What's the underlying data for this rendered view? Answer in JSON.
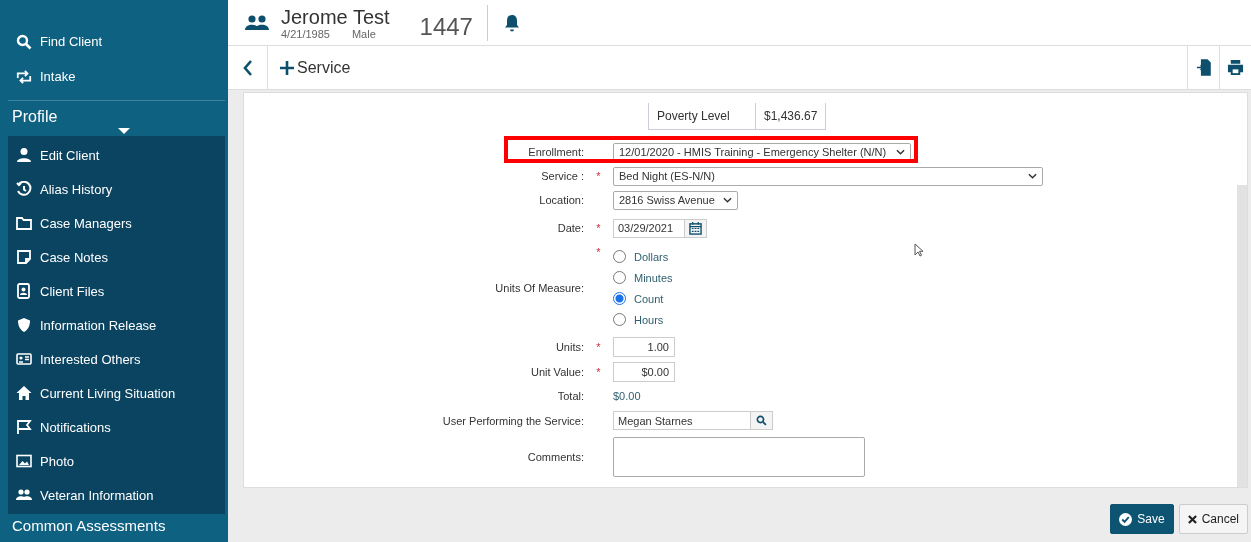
{
  "sidebar": {
    "items": [
      {
        "label": "Find Client"
      },
      {
        "label": "Intake"
      }
    ],
    "section": {
      "title": "Profile"
    },
    "profile_items": [
      {
        "label": "Edit Client"
      },
      {
        "label": "Alias History"
      },
      {
        "label": "Case Managers"
      },
      {
        "label": "Case Notes"
      },
      {
        "label": "Client Files"
      },
      {
        "label": "Information Release"
      },
      {
        "label": "Interested Others"
      },
      {
        "label": "Current Living Situation"
      },
      {
        "label": "Notifications"
      },
      {
        "label": "Photo"
      },
      {
        "label": "Veteran Information"
      }
    ],
    "next_section": "Common Assessments"
  },
  "client": {
    "name": "Jerome Test",
    "dob": "4/21/1985",
    "gender": "Male",
    "client_id": "1447"
  },
  "toolbar": {
    "title": "Service"
  },
  "poverty": {
    "label": "Poverty Level",
    "value": "$1,436.67"
  },
  "fields": [
    {
      "kind": "select",
      "label": "Enrollment:",
      "value": "12/01/2020 - HMIS Training - Emergency Shelter (N/N)",
      "highlighted": true
    },
    {
      "kind": "select",
      "label": "Service :",
      "required_mark": "*",
      "value": "Bed Night (ES-N/N)",
      "highlighted": false
    },
    {
      "kind": "select",
      "label": "Location:",
      "value": "2816 Swiss Avenue",
      "highlighted": false
    },
    {
      "kind": "date",
      "label": "Date:",
      "required_mark": "*",
      "value": "03/29/2021",
      "highlighted": false
    },
    {
      "kind": "radio",
      "label": "Units Of Measure:",
      "required_mark": "*",
      "options": [
        {
          "label": "Dollars",
          "selected": false
        },
        {
          "label": "Minutes",
          "selected": false
        },
        {
          "label": "Count",
          "selected": true
        },
        {
          "label": "Hours",
          "selected": false
        }
      ],
      "highlighted": false
    },
    {
      "kind": "number",
      "label": "Units:",
      "required_mark": "*",
      "value": "1.00",
      "highlighted": false
    },
    {
      "kind": "number",
      "label": "Unit Value:",
      "required_mark": "*",
      "value": "$0.00",
      "highlighted": false
    },
    {
      "kind": "static",
      "label": "Total:",
      "value": "$0.00",
      "highlighted": false
    },
    {
      "kind": "lookup",
      "label": "User Performing the Service:",
      "value": "Megan Starnes",
      "highlighted": false
    },
    {
      "kind": "textarea",
      "label": "Comments:",
      "highlighted": false
    }
  ],
  "buttons": [
    {
      "kind": "save",
      "label": "Save"
    },
    {
      "kind": "cancel",
      "label": "Cancel"
    }
  ]
}
